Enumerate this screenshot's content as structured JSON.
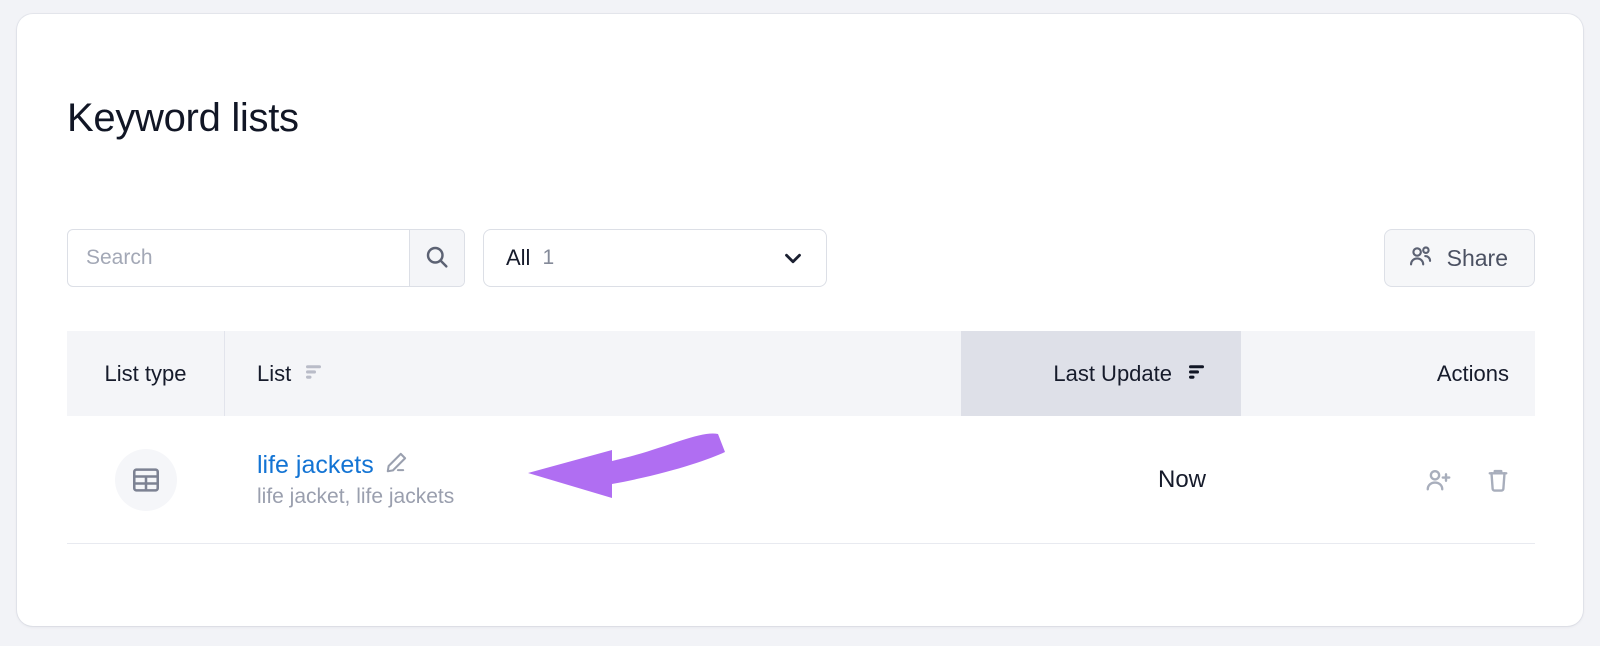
{
  "page": {
    "title": "Keyword lists",
    "background_color": "#f2f3f7",
    "card_color": "#ffffff"
  },
  "toolbar": {
    "search_placeholder": "Search",
    "search_value": "",
    "search_icon": "search-icon",
    "filter": {
      "label": "All",
      "count": "1",
      "chevron_icon": "chevron-down-icon"
    },
    "share": {
      "label": "Share",
      "icon": "people-icon"
    }
  },
  "table": {
    "columns": [
      {
        "key": "list_type",
        "label": "List type",
        "sort_icon": false,
        "active": false
      },
      {
        "key": "list",
        "label": "List",
        "sort_icon": true,
        "active": false
      },
      {
        "key": "last_update",
        "label": "Last Update",
        "sort_icon": true,
        "active": true
      },
      {
        "key": "actions",
        "label": "Actions",
        "sort_icon": false,
        "active": false
      }
    ],
    "rows": [
      {
        "list_type_icon": "table-grid-icon",
        "name": "life jackets",
        "edit_icon": "pencil-icon",
        "keywords": "life jacket, life jackets",
        "last_update": "Now",
        "actions": [
          "add-user-icon",
          "trash-icon"
        ]
      }
    ]
  },
  "annotation": {
    "type": "curved-arrow-left",
    "color": "#b06ef2",
    "points_to": "life jackets"
  },
  "colors": {
    "link": "#1374d4",
    "header_bg": "#f4f5f8",
    "active_header_bg": "#dee0e8",
    "muted_text": "#9a9fae",
    "accent_purple": "#b06ef2"
  }
}
